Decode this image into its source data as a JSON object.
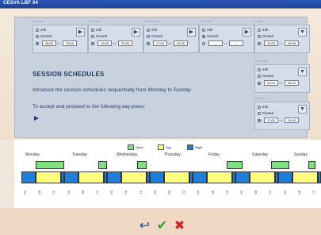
{
  "window": {
    "title": "CESVA LBF 04"
  },
  "day_panels": [
    {
      "label": "Monday",
      "selected": "range",
      "from": "08:00",
      "to": "23:59",
      "button": "▶"
    },
    {
      "label": "Tuesday",
      "selected": "range",
      "from": "19:00",
      "to": "23:59",
      "button": "▶"
    },
    {
      "label": "Wednesday",
      "selected": "range",
      "from": "17:00",
      "to": "22:00",
      "button": "▶"
    },
    {
      "label": "Thursday",
      "selected": "closed",
      "from": "---",
      "to": "---",
      "button": "▶"
    },
    {
      "label": "Friday",
      "selected": "range",
      "from": "19:00",
      "to": "04:00",
      "button": "▼"
    },
    {
      "label": "Saturday",
      "selected": "range",
      "from": "20:00",
      "to": "06:00",
      "button": "▼"
    },
    {
      "label": "Sunday",
      "selected": "range",
      "from": "17:00",
      "to": "21:00",
      "button": "▼"
    }
  ],
  "options": {
    "h24": "24h",
    "closed": "Closed"
  },
  "session": {
    "title": "SESSION SCHEDULES",
    "intro": "Introduce the session schedules sequentially from Monday to Sunday",
    "accept": "To accept and proceed to the following day press:"
  },
  "legend": [
    {
      "label": "Open",
      "color": "#80e080"
    },
    {
      "label": "Day",
      "color": "#ffff80"
    },
    {
      "label": "Night",
      "color": "#1f7fd8"
    }
  ],
  "chart_days": [
    "Monday",
    "Tuesday",
    "Wednesday",
    "Thursday",
    "Friday",
    "Saturday",
    "Sunday"
  ],
  "ticks": [
    "00",
    "08",
    "22",
    "00",
    "08",
    "22",
    "00",
    "08",
    "22",
    "00",
    "08",
    "22",
    "00",
    "08",
    "22",
    "00",
    "08",
    "22",
    "00",
    "08",
    "22"
  ],
  "buttons": {
    "back": "↩",
    "ok": "✔",
    "cancel": "✖"
  },
  "colors": {
    "open": "#80e080",
    "day": "#ffff80",
    "night": "#1f7fd8",
    "back": "#1f4f9f",
    "ok": "#2c9b2c",
    "cancel": "#d42020"
  }
}
